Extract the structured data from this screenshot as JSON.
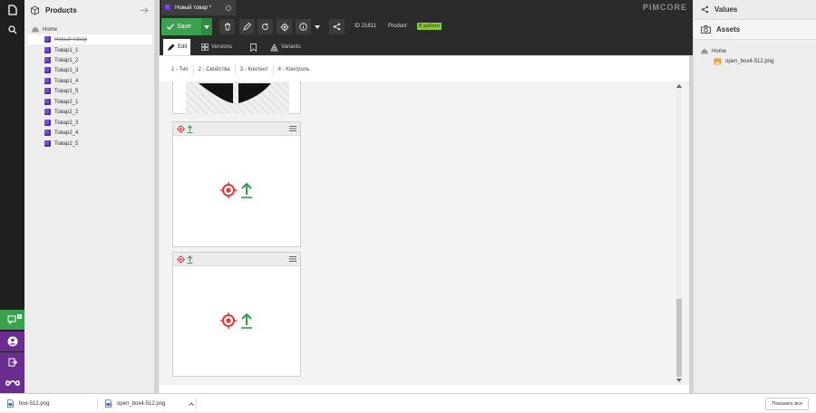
{
  "colors": {
    "accent_green": "#3aa14f",
    "brand_purple": "#6a2d8f",
    "dark": "#2b2b2b",
    "status_badge": "#8cc63f",
    "target_red": "#e53935",
    "arrow_green": "#2e9e4f"
  },
  "tree": {
    "title": "Products",
    "items": [
      {
        "label": "Home",
        "icon": "home-icon"
      },
      {
        "label": "Новый товар",
        "icon": "cube-icon"
      },
      {
        "label": "Товар1_1",
        "icon": "cube-icon"
      },
      {
        "label": "Товар1_2",
        "icon": "cube-icon"
      },
      {
        "label": "Товар1_3",
        "icon": "cube-icon"
      },
      {
        "label": "Товар1_4",
        "icon": "cube-icon"
      },
      {
        "label": "Товар1_5",
        "icon": "cube-icon"
      },
      {
        "label": "Товар2_1",
        "icon": "cube-icon"
      },
      {
        "label": "Товар2_2",
        "icon": "cube-icon"
      },
      {
        "label": "Товар2_3",
        "icon": "cube-icon"
      },
      {
        "label": "Товар2_4",
        "icon": "cube-icon"
      },
      {
        "label": "Товар2_5",
        "icon": "cube-icon"
      }
    ]
  },
  "topbar": {
    "tab_title": "Новый товар *",
    "brand": "PIMCORE"
  },
  "toolbar": {
    "save_label": "Save",
    "id_text": "ID 21611",
    "class_text": "Product",
    "status": "В работе"
  },
  "subtabs": {
    "edit": "Edit",
    "versions": "Versions",
    "variants": "Variants"
  },
  "layout_tabs": [
    "1 - Тип",
    "2 - Свойства",
    "3 - Контент",
    "4 - Контроль"
  ],
  "right": {
    "values_title": "Values",
    "assets_title": "Assets",
    "assets_home": "Home",
    "assets_file": "open_box4-512.png"
  },
  "downloads": {
    "items": [
      "box-512.png",
      "open_box4-512.png"
    ],
    "show_all": "Показать все"
  },
  "nav": {
    "chat_badge": "1"
  }
}
